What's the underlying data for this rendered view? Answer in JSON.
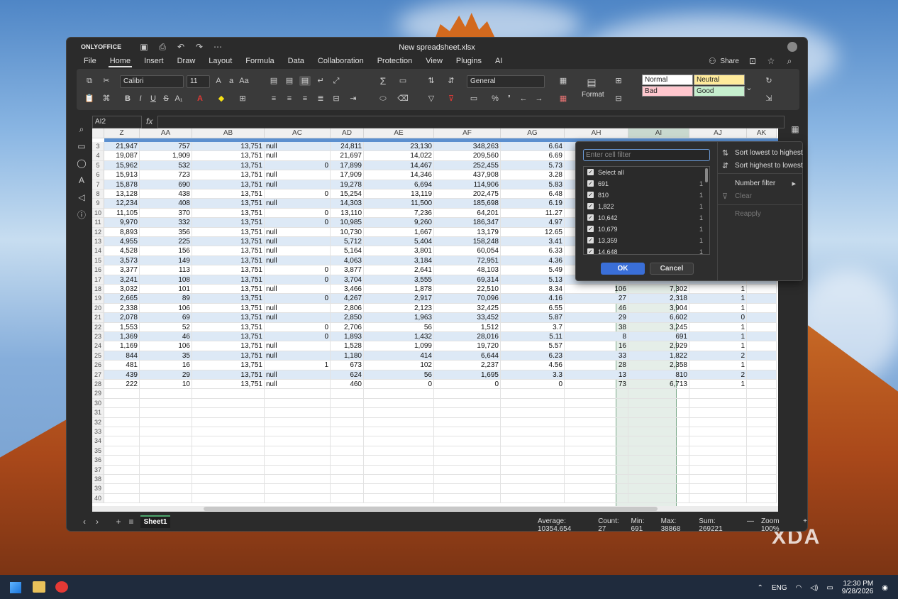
{
  "app": {
    "brand": "ONLYOFFICE",
    "doc_title": "New spreadsheet.xlsx",
    "share_label": "Share"
  },
  "menu": [
    "File",
    "Home",
    "Insert",
    "Draw",
    "Layout",
    "Formula",
    "Data",
    "Collaboration",
    "Protection",
    "View",
    "Plugins",
    "AI"
  ],
  "toolbar": {
    "font": "Calibri",
    "size": "11",
    "number_format": "General",
    "format_label": "Format",
    "styles": [
      {
        "label": "Normal",
        "bg": "#ffffff"
      },
      {
        "label": "Neutral",
        "bg": "#ffeb9c"
      },
      {
        "label": "Bad",
        "bg": "#ffc7ce"
      },
      {
        "label": "Good",
        "bg": "#c6efce"
      }
    ]
  },
  "formula_bar": {
    "cell_ref": "AI2",
    "fx": "fx"
  },
  "columns": [
    "Z",
    "AA",
    "AB",
    "AC",
    "AD",
    "AE",
    "AF",
    "AG",
    "AH",
    "AI",
    "AJ",
    "AK"
  ],
  "rows": [
    {
      "n": "3",
      "c": [
        "21,947",
        "757",
        "13,751",
        "null",
        "24,811",
        "23,130",
        "348,263",
        "6.64",
        "",
        "",
        "",
        ""
      ]
    },
    {
      "n": "4",
      "c": [
        "19,087",
        "1,909",
        "13,751",
        "null",
        "21,697",
        "14,022",
        "209,560",
        "6.69",
        "",
        "",
        "",
        ""
      ]
    },
    {
      "n": "5",
      "c": [
        "15,962",
        "532",
        "13,751",
        "0",
        "17,899",
        "14,467",
        "252,455",
        "5.73",
        "",
        "",
        "",
        ""
      ]
    },
    {
      "n": "6",
      "c": [
        "15,913",
        "723",
        "13,751",
        "null",
        "17,909",
        "14,346",
        "437,908",
        "3.28",
        "",
        "",
        "",
        ""
      ]
    },
    {
      "n": "7",
      "c": [
        "15,878",
        "690",
        "13,751",
        "null",
        "19,278",
        "6,694",
        "114,906",
        "5.83",
        "",
        "",
        "",
        ""
      ]
    },
    {
      "n": "8",
      "c": [
        "13,128",
        "438",
        "13,751",
        "0",
        "15,254",
        "13,119",
        "202,475",
        "6.48",
        "",
        "",
        "",
        ""
      ]
    },
    {
      "n": "9",
      "c": [
        "12,234",
        "408",
        "13,751",
        "null",
        "14,303",
        "11,500",
        "185,698",
        "6.19",
        "",
        "",
        "",
        ""
      ]
    },
    {
      "n": "10",
      "c": [
        "11,105",
        "370",
        "13,751",
        "0",
        "13,110",
        "7,236",
        "64,201",
        "11.27",
        "",
        "",
        "",
        ""
      ]
    },
    {
      "n": "11",
      "c": [
        "9,970",
        "332",
        "13,751",
        "0",
        "10,985",
        "9,260",
        "186,347",
        "4.97",
        "",
        "",
        "",
        ""
      ]
    },
    {
      "n": "12",
      "c": [
        "8,893",
        "356",
        "13,751",
        "null",
        "10,730",
        "1,667",
        "13,179",
        "12.65",
        "",
        "",
        "",
        ""
      ]
    },
    {
      "n": "13",
      "c": [
        "4,955",
        "225",
        "13,751",
        "null",
        "5,712",
        "5,404",
        "158,248",
        "3.41",
        "",
        "",
        "",
        ""
      ]
    },
    {
      "n": "14",
      "c": [
        "4,528",
        "156",
        "13,751",
        "null",
        "5,164",
        "3,801",
        "60,054",
        "6.33",
        "",
        "",
        "",
        ""
      ]
    },
    {
      "n": "15",
      "c": [
        "3,573",
        "149",
        "13,751",
        "null",
        "4,063",
        "3,184",
        "72,951",
        "4.36",
        "",
        "",
        "",
        ""
      ]
    },
    {
      "n": "16",
      "c": [
        "3,377",
        "113",
        "13,751",
        "0",
        "3,877",
        "2,641",
        "48,103",
        "5.49",
        "",
        "",
        "",
        ""
      ]
    },
    {
      "n": "17",
      "c": [
        "3,241",
        "108",
        "13,751",
        "0",
        "3,704",
        "3,555",
        "69,314",
        "5.13",
        "",
        "",
        "",
        ""
      ]
    },
    {
      "n": "18",
      "c": [
        "3,032",
        "101",
        "13,751",
        "null",
        "3,466",
        "1,878",
        "22,510",
        "8.34",
        "106",
        "7,302",
        "1",
        ""
      ]
    },
    {
      "n": "19",
      "c": [
        "2,665",
        "89",
        "13,751",
        "0",
        "4,267",
        "2,917",
        "70,096",
        "4.16",
        "27",
        "2,318",
        "1",
        ""
      ]
    },
    {
      "n": "20",
      "c": [
        "2,338",
        "106",
        "13,751",
        "null",
        "2,806",
        "2,123",
        "32,425",
        "6.55",
        "46",
        "3,904",
        "1",
        ""
      ]
    },
    {
      "n": "21",
      "c": [
        "2,078",
        "69",
        "13,751",
        "null",
        "2,850",
        "1,963",
        "33,452",
        "5.87",
        "29",
        "6,602",
        "0",
        ""
      ]
    },
    {
      "n": "22",
      "c": [
        "1,553",
        "52",
        "13,751",
        "0",
        "2,706",
        "56",
        "1,512",
        "3.7",
        "38",
        "3,245",
        "1",
        ""
      ]
    },
    {
      "n": "23",
      "c": [
        "1,369",
        "46",
        "13,751",
        "0",
        "1,893",
        "1,432",
        "28,016",
        "5.11",
        "8",
        "691",
        "1",
        ""
      ]
    },
    {
      "n": "24",
      "c": [
        "1,169",
        "106",
        "13,751",
        "null",
        "1,528",
        "1,099",
        "19,720",
        "5.57",
        "16",
        "2,929",
        "1",
        ""
      ]
    },
    {
      "n": "25",
      "c": [
        "844",
        "35",
        "13,751",
        "null",
        "1,180",
        "414",
        "6,644",
        "6.23",
        "33",
        "1,822",
        "2",
        ""
      ]
    },
    {
      "n": "26",
      "c": [
        "481",
        "16",
        "13,751",
        "1",
        "673",
        "102",
        "2,237",
        "4.56",
        "28",
        "2,358",
        "1",
        ""
      ]
    },
    {
      "n": "27",
      "c": [
        "439",
        "29",
        "13,751",
        "null",
        "624",
        "56",
        "1,695",
        "3.3",
        "13",
        "810",
        "2",
        ""
      ]
    },
    {
      "n": "28",
      "c": [
        "222",
        "10",
        "13,751",
        "null",
        "460",
        "0",
        "0",
        "0",
        "73",
        "6,713",
        "1",
        ""
      ]
    }
  ],
  "empty_rows": [
    "29",
    "30",
    "31",
    "32",
    "33",
    "34",
    "35",
    "36",
    "37",
    "38",
    "39",
    "40"
  ],
  "filter": {
    "placeholder": "Enter cell filter",
    "ok": "OK",
    "cancel": "Cancel",
    "items": [
      {
        "label": "Select all",
        "count": ""
      },
      {
        "label": "691",
        "count": "1"
      },
      {
        "label": "810",
        "count": "1"
      },
      {
        "label": "1,822",
        "count": "1"
      },
      {
        "label": "10,642",
        "count": "1"
      },
      {
        "label": "10,679",
        "count": "1"
      },
      {
        "label": "13,359",
        "count": "1"
      },
      {
        "label": "14,648",
        "count": "1"
      }
    ],
    "menu": {
      "sort_asc": "Sort lowest to highest",
      "sort_desc": "Sort highest to lowest",
      "number_filter": "Number filter",
      "clear": "Clear",
      "reapply": "Reapply"
    }
  },
  "sheet": {
    "tab": "Sheet1"
  },
  "status": {
    "average": "Average: 10354.654",
    "count": "Count: 27",
    "min": "Min: 691",
    "max": "Max: 38868",
    "sum": "Sum: 269221",
    "zoom": "Zoom 100%"
  },
  "taskbar": {
    "lang": "ENG",
    "time": "12:30 PM",
    "date": "9/28/2026"
  },
  "watermark": "XDA"
}
